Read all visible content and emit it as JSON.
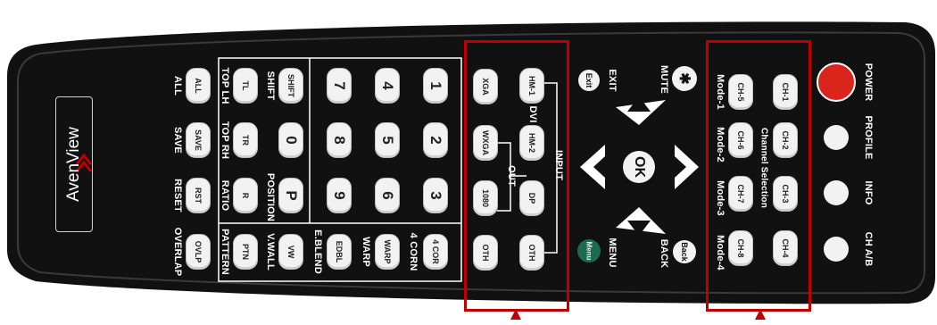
{
  "brand": "AvenView",
  "top_row": {
    "labels": [
      "POWER",
      "PROFILE",
      "INFO",
      "CH A/B"
    ],
    "power_color": "#d9251c"
  },
  "channel_selection": {
    "title": "Channel Selection",
    "channels": [
      "CH-1",
      "CH-2",
      "CH-3",
      "CH-4",
      "CH-5",
      "CH-6",
      "CH-7",
      "CH-8"
    ],
    "modes": [
      "Mode-1",
      "Mode-2",
      "Mode-3",
      "Mode-4"
    ]
  },
  "navigation": {
    "mute_label": "MUTE",
    "exit_button": "Exit",
    "exit_label": "EXIT",
    "ok_button": "OK",
    "back_button": "Back",
    "back_label": "BACK",
    "menu_button": "Menu",
    "menu_label": "MENU"
  },
  "input": {
    "title": "INPUT",
    "dvi_label": "DVI",
    "buttons": [
      "HM-1",
      "HM-2",
      "DP",
      "OTH"
    ]
  },
  "output": {
    "title": "OUT",
    "buttons": [
      "XGA",
      "WXGA",
      "1080",
      "OTH"
    ]
  },
  "number_pad": {
    "keys": [
      "1",
      "2",
      "3",
      "4",
      "5",
      "6",
      "7",
      "8",
      "9",
      "SHIFT",
      "0",
      "P"
    ],
    "shift_label": "SHIFT",
    "position_label": "POSITION"
  },
  "function_keys": {
    "row1": [
      "TL",
      "TR",
      "R",
      "PTN"
    ],
    "row1_labels": [
      "TOP LH",
      "TOP RH",
      "RATIO",
      "PATTERN"
    ],
    "row2": [
      "ALL",
      "SAVE",
      "RST",
      "OVLP"
    ],
    "row2_labels": [
      "ALL",
      "SAVE",
      "RESET",
      "OVERLAP"
    ],
    "warp_keys": [
      "4 COR",
      "WARP",
      "EDBL",
      "VW"
    ],
    "warp_labels": [
      "4 CORN",
      "WARP",
      "E.BLEND",
      "V.WALL"
    ]
  },
  "colors": {
    "body": "#111111",
    "highlight": "#c00000",
    "menu_button": "#1c6b50"
  }
}
